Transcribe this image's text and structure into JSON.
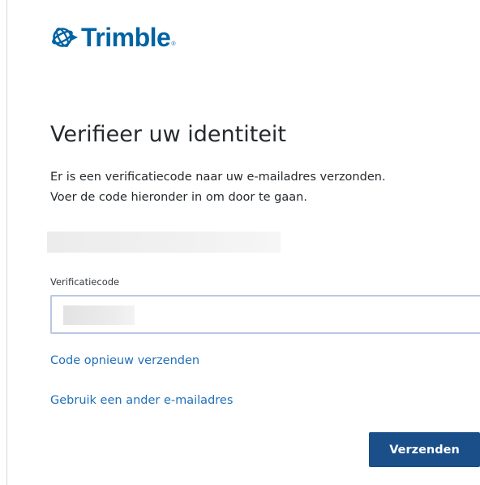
{
  "brand": {
    "name": "Trimble",
    "registered_mark": "®",
    "logo_icon": "trimble-globe-icon",
    "color": "#0063a3"
  },
  "page": {
    "title": "Verifieer uw identiteit",
    "description_line1": "Er is een verificatiecode naar uw e-mailadres verzonden.",
    "description_line2": "Voer de code hieronder in om door te gaan."
  },
  "form": {
    "code_label": "Verificatiecode",
    "code_value": "",
    "resend_link": "Code opnieuw verzenden",
    "other_email_link": "Gebruik een ander e-mailadres",
    "submit_label": "Verzenden"
  },
  "colors": {
    "link": "#1f6fb8",
    "button": "#1a4f8a",
    "input_border": "#b9c8e6",
    "text": "#252a2e"
  }
}
